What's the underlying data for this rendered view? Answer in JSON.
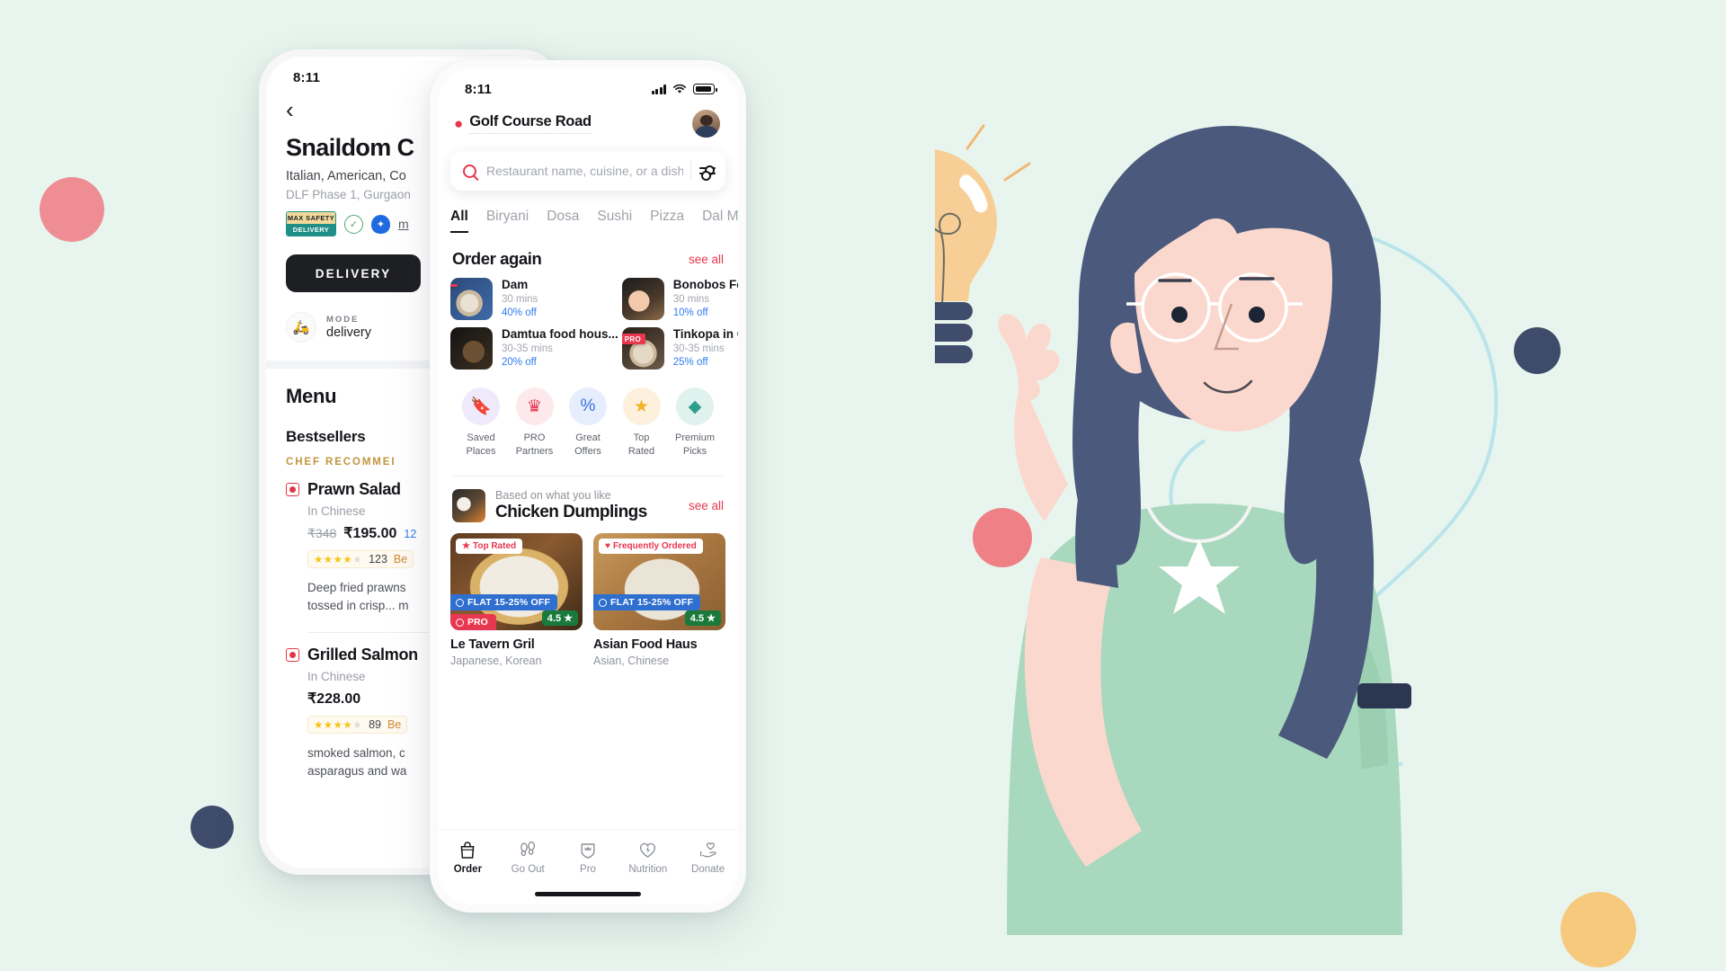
{
  "page": {
    "background_color": "#e8f5ee",
    "accent_color": "#e8384f"
  },
  "restaurant_screen": {
    "status_bar": {
      "time": "8:11"
    },
    "back_icon": "‹",
    "title": "Snaildom C",
    "cuisines": "Italian, American, Co",
    "locality": "DLF Phase 1, Gurgaon",
    "badges": {
      "max_safety_top": "MAX SAFETY",
      "max_safety_bottom": "DELIVERY",
      "veg_icon": "veg-leaf-icon",
      "shield_icon": "shield-icon",
      "more_link": "m"
    },
    "delivery_button": "DELIVERY",
    "mode": {
      "label": "MODE",
      "caret": "▾",
      "value": "delivery"
    },
    "menu_heading": "Menu",
    "bestsellers_heading": "Bestsellers",
    "chef_recommends": "CHEF RECOMMEI",
    "dishes": [
      {
        "name": "Prawn Salad",
        "sub": "In Chinese",
        "price_original": "₹348",
        "price_current": "₹195.00",
        "price_extra": "12",
        "stars": "★★★★",
        "star_off": "★",
        "rating_count": "123",
        "rating_tag": "Be",
        "description_line1": "Deep fried prawns",
        "description_line2": "tossed in crisp... m"
      },
      {
        "name": "Grilled Salmon",
        "sub": "In Chinese",
        "price_original": "",
        "price_current": "₹228.00",
        "price_extra": "",
        "stars": "★★★★",
        "star_off": "★",
        "rating_count": "89",
        "rating_tag": "Be",
        "description_line1": "smoked salmon, c",
        "description_line2": "asparagus and wa"
      }
    ]
  },
  "home_screen": {
    "status_bar": {
      "time": "8:11"
    },
    "location": {
      "pin_icon": "📍",
      "label": "Golf Course Road"
    },
    "avatar": "user-avatar",
    "search": {
      "placeholder": "Restaurant name, cuisine, or a dish",
      "value": "",
      "filter_icon": "filter-sliders-icon"
    },
    "categories": [
      {
        "label": "All",
        "active": true
      },
      {
        "label": "Biryani",
        "active": false
      },
      {
        "label": "Dosa",
        "active": false
      },
      {
        "label": "Sushi",
        "active": false
      },
      {
        "label": "Pizza",
        "active": false
      },
      {
        "label": "Dal Makh",
        "active": false
      }
    ],
    "order_again": {
      "title": "Order again",
      "see_all": "see all",
      "items": [
        {
          "name": "Dam",
          "time": "30 mins",
          "offer": "40% off",
          "pro": true,
          "pro_label": "PRO",
          "thumb": "th-dam"
        },
        {
          "name": "Bonobos Foodo",
          "time": "30 mins",
          "offer": "10% off",
          "pro": false,
          "pro_label": "PRO",
          "thumb": "th-bono"
        },
        {
          "name": "Damtua food hous...",
          "time": "30-35 mins",
          "offer": "20% off",
          "pro": false,
          "pro_label": "PRO",
          "thumb": "th-damtua"
        },
        {
          "name": "Tinkopa in Cafe",
          "time": "30-35 mins",
          "offer": "25% off",
          "pro": true,
          "pro_label": "PRO",
          "thumb": "th-tink"
        }
      ]
    },
    "quick_actions": [
      {
        "line1": "Saved",
        "line2": "Places",
        "icon": "bookmark-icon",
        "glyph": "🔖",
        "style": "qi-saved"
      },
      {
        "line1": "PRO",
        "line2": "Partners",
        "icon": "crown-shield-icon",
        "glyph": "♛",
        "style": "qi-pro"
      },
      {
        "line1": "Great",
        "line2": "Offers",
        "icon": "percent-badge-icon",
        "glyph": "%",
        "style": "qi-offer"
      },
      {
        "line1": "Top",
        "line2": "Rated",
        "icon": "star-icon",
        "glyph": "★",
        "style": "qi-top"
      },
      {
        "line1": "Premium",
        "line2": "Picks",
        "icon": "diamond-icon",
        "glyph": "◆",
        "style": "qi-prem"
      }
    ],
    "based_on": {
      "subtitle": "Based on what you like",
      "title": "Chicken Dumplings",
      "see_all": "see all"
    },
    "restaurants": [
      {
        "name": "Le Tavern Gril",
        "cuisines": "Japanese, Korean",
        "badge": "Top Rated",
        "badge_icon": "star-icon",
        "flat_offer": "FLAT 15-25% OFF",
        "pro": true,
        "pro_label": "PRO",
        "rating": "4.5 ★",
        "image": "ri-1"
      },
      {
        "name": "Asian Food Haus",
        "cuisines": "Asian, Chinese",
        "badge": "Frequently Ordered",
        "badge_icon": "heart-icon",
        "flat_offer": "FLAT 15-25% OFF",
        "pro": false,
        "pro_label": "PRO",
        "rating": "4.5 ★",
        "image": "ri-2"
      }
    ],
    "tabs": [
      {
        "label": "Order",
        "icon": "bag-icon",
        "active": true
      },
      {
        "label": "Go Out",
        "icon": "footsteps-icon",
        "active": false
      },
      {
        "label": "Pro",
        "icon": "crown-shield-icon",
        "active": false
      },
      {
        "label": "Nutrition",
        "icon": "heart-bolt-icon",
        "active": false
      },
      {
        "label": "Donate",
        "icon": "hand-heart-icon",
        "active": false
      }
    ]
  }
}
